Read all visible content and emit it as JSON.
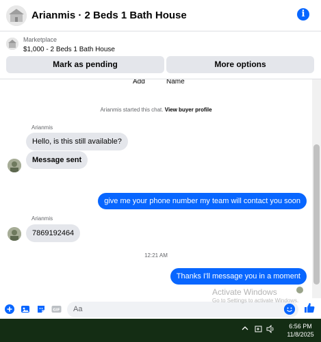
{
  "header": {
    "title": "Arianmis · 2 Beds 1 Bath House"
  },
  "marketplace": {
    "label": "Marketplace",
    "listing": "$1,000 - 2 Beds 1 Bath House",
    "pending_button": "Mark as pending",
    "more_button": "More options"
  },
  "partial_row": {
    "add": "Add",
    "name": "Name"
  },
  "notice": {
    "text": "Arianmis started this chat.",
    "link": "View buyer profile"
  },
  "messages": {
    "sender_1": "Arianmis",
    "in_1": "Hello, is this still available?",
    "in_2": "Message sent",
    "out_1": "give me your phone number my team will contact you soon",
    "sender_2": "Arianmis",
    "in_3": "7869192464",
    "timestamp": "12:21 AM",
    "out_2": "Thanks I'll message you in a moment"
  },
  "composer": {
    "placeholder": "Aa"
  },
  "watermark": {
    "title": "Activate Windows",
    "subtitle": "Go to Settings to activate Windows."
  },
  "taskbar": {
    "time": "6:56 PM",
    "date": "11/8/2025"
  },
  "colors": {
    "accent": "#0866ff",
    "incoming_bubble": "#e4e6eb",
    "taskbar": "#142d14"
  }
}
